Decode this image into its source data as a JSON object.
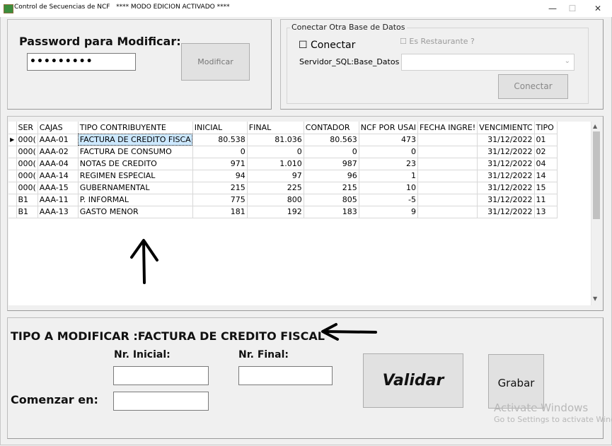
{
  "window": {
    "title": "Control de Secuencias de NCF",
    "mode": "**** MODO EDICION ACTIVADO ****",
    "minimize": "—",
    "maximize": "☐",
    "close": "✕"
  },
  "password": {
    "label": "Password para Modificar:",
    "value": "•••••••••",
    "button": "Modificar"
  },
  "connect": {
    "group_title": "Conectar Otra Base de Datos",
    "checkbox_label": "Conectar",
    "restaurante_label": "Es Restaurante ?",
    "server_label": "Servidor_SQL:Base_Datos",
    "server_value": "",
    "button": "Conectar"
  },
  "grid": {
    "columns": [
      "SER",
      "CAJAS",
      "TIPO CONTRIBUYENTE",
      "INICIAL",
      "FINAL",
      "CONTADOR",
      "NCF POR USAI",
      "FECHA INGRE!",
      "VENCIMIENTC",
      "TIPO"
    ],
    "rows": [
      [
        "000(",
        "AAA-01",
        "FACTURA DE CREDITO FISCA",
        "80.538",
        "81.036",
        "80.563",
        "473",
        "",
        "31/12/2022",
        "01"
      ],
      [
        "000(",
        "AAA-02",
        "FACTURA DE CONSUMO",
        "0",
        "0",
        "0",
        "0",
        "",
        "31/12/2022",
        "02"
      ],
      [
        "000(",
        "AAA-04",
        "NOTAS DE CREDITO",
        "971",
        "1.010",
        "987",
        "23",
        "",
        "31/12/2022",
        "04"
      ],
      [
        "000(",
        "AAA-14",
        "REGIMEN ESPECIAL",
        "94",
        "97",
        "96",
        "1",
        "",
        "31/12/2022",
        "14"
      ],
      [
        "000(",
        "AAA-15",
        "GUBERNAMENTAL",
        "215",
        "225",
        "215",
        "10",
        "",
        "31/12/2022",
        "15"
      ],
      [
        "B1",
        "AAA-11",
        "P. INFORMAL",
        "775",
        "800",
        "805",
        "-5",
        "",
        "31/12/2022",
        "11"
      ],
      [
        "B1",
        "AAA-13",
        "GASTO MENOR",
        "181",
        "192",
        "183",
        "9",
        "",
        "31/12/2022",
        "13"
      ]
    ]
  },
  "edit": {
    "tipo_label": "TIPO A MODIFICAR :FACTURA DE CREDITO FISCAL",
    "inicial_label": "Nr. Inicial:",
    "final_label": "Nr. Final:",
    "comenzar_label": "Comenzar en:",
    "inicial_value": "",
    "final_value": "",
    "comenzar_value": "",
    "validar_button": "Validar",
    "grabar_button": "Grabar"
  },
  "watermark": {
    "line1": "Activate Windows",
    "line2": "Go to Settings to activate Wind"
  },
  "colors": {
    "selected_cell": "#cce8ff",
    "window_bg": "#f0f0f0"
  }
}
